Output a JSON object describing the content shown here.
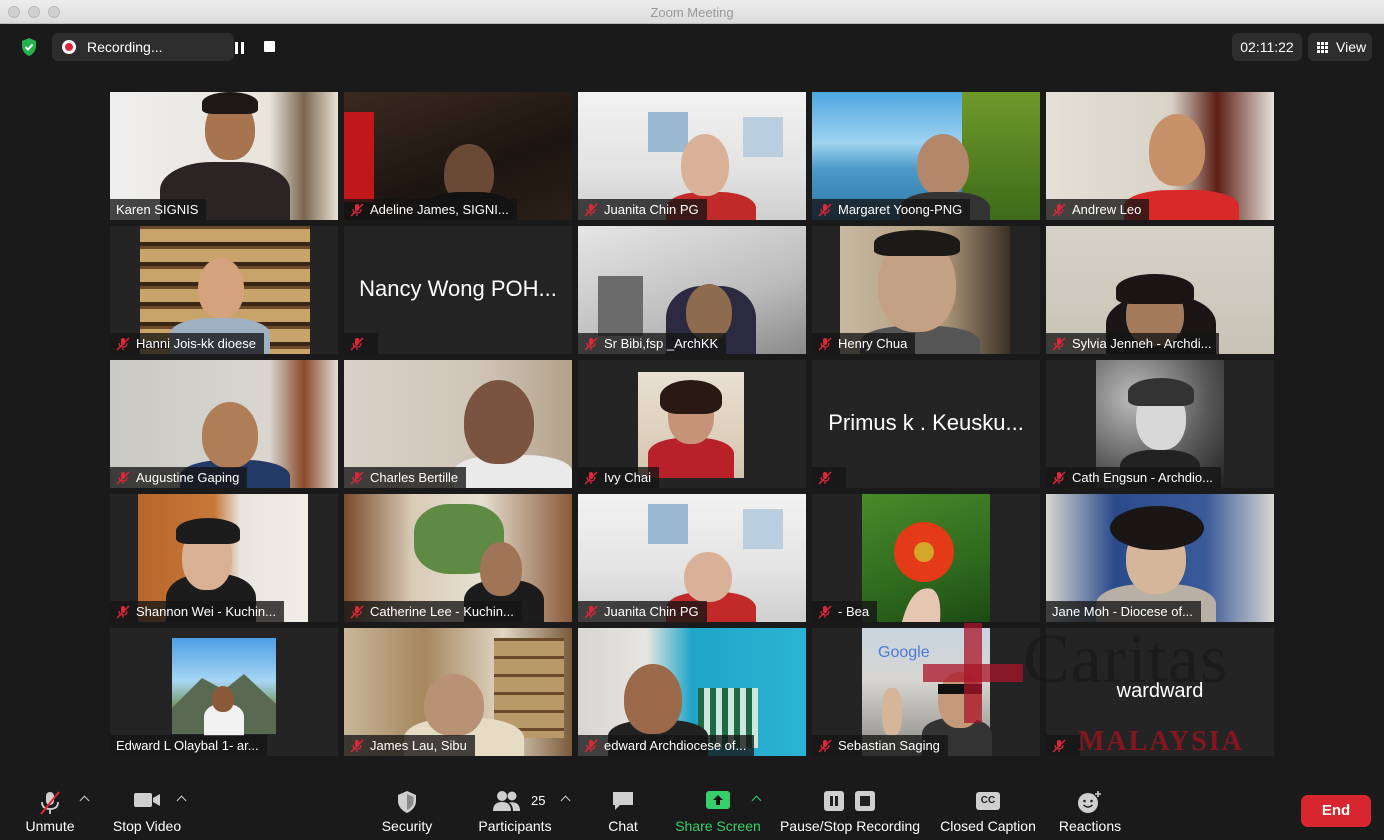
{
  "window": {
    "title": "Zoom Meeting"
  },
  "topbar": {
    "recording_label": "Recording...",
    "timer": "02:11:22",
    "view_label": "View"
  },
  "tiles": [
    {
      "name": "Karen SIGNIS",
      "muted": false,
      "video": true,
      "active": true
    },
    {
      "name": "Adeline James, SIGNI...",
      "muted": true,
      "video": true
    },
    {
      "name": "Juanita Chin PG",
      "muted": true,
      "video": true
    },
    {
      "name": "Margaret Yoong-PNG",
      "muted": true,
      "video": true
    },
    {
      "name": "Andrew Leo",
      "muted": true,
      "video": true
    },
    {
      "name": "Hanni Jois-kk dioese",
      "muted": true,
      "video": true
    },
    {
      "name": "Nancy Wong POH...",
      "muted": true,
      "video": false
    },
    {
      "name": "Sr Bibi,fsp _ArchKK",
      "muted": true,
      "video": true
    },
    {
      "name": "Henry Chua",
      "muted": true,
      "video": true
    },
    {
      "name": "Sylvia Jenneh - Archdi...",
      "muted": true,
      "video": true
    },
    {
      "name": "Augustine Gaping",
      "muted": true,
      "video": true
    },
    {
      "name": "Charles Bertille",
      "muted": true,
      "video": true
    },
    {
      "name": "Ivy Chai",
      "muted": true,
      "video": true
    },
    {
      "name": "Primus k . Keusku...",
      "muted": true,
      "video": false
    },
    {
      "name": "Cath Engsun - Archdio...",
      "muted": true,
      "video": true
    },
    {
      "name": "Shannon Wei - Kuchin...",
      "muted": true,
      "video": true
    },
    {
      "name": "Catherine Lee - Kuchin...",
      "muted": true,
      "video": true
    },
    {
      "name": "Juanita Chin PG",
      "muted": true,
      "video": true
    },
    {
      "name": "- Bea",
      "muted": true,
      "video": true
    },
    {
      "name": "Jane Moh - Diocese of...",
      "muted": false,
      "video": true
    },
    {
      "name": "Edward L Olaybal 1- ar...",
      "muted": false,
      "video": true
    },
    {
      "name": "James Lau, Sibu",
      "muted": true,
      "video": true
    },
    {
      "name": "edward Archdiocese of...",
      "muted": true,
      "video": true
    },
    {
      "name": "Sebastian Saging",
      "muted": true,
      "video": true
    },
    {
      "name": "wardward",
      "muted": true,
      "video": false
    }
  ],
  "watermark": {
    "line1": "Caritas",
    "line2": "MALAYSIA",
    "google_sign": "Google"
  },
  "toolbar": {
    "unmute": "Unmute",
    "stop_video": "Stop Video",
    "security": "Security",
    "participants": "Participants",
    "participants_count": "25",
    "chat": "Chat",
    "share_screen": "Share Screen",
    "pause_stop_recording": "Pause/Stop Recording",
    "closed_caption": "Closed Caption",
    "cc_badge": "CC",
    "reactions": "Reactions",
    "end": "End"
  },
  "colors": {
    "active_speaker": "#d9ee5e",
    "end": "#d8262e",
    "share": "#35d06b",
    "muted_icon": "#e0263b"
  }
}
